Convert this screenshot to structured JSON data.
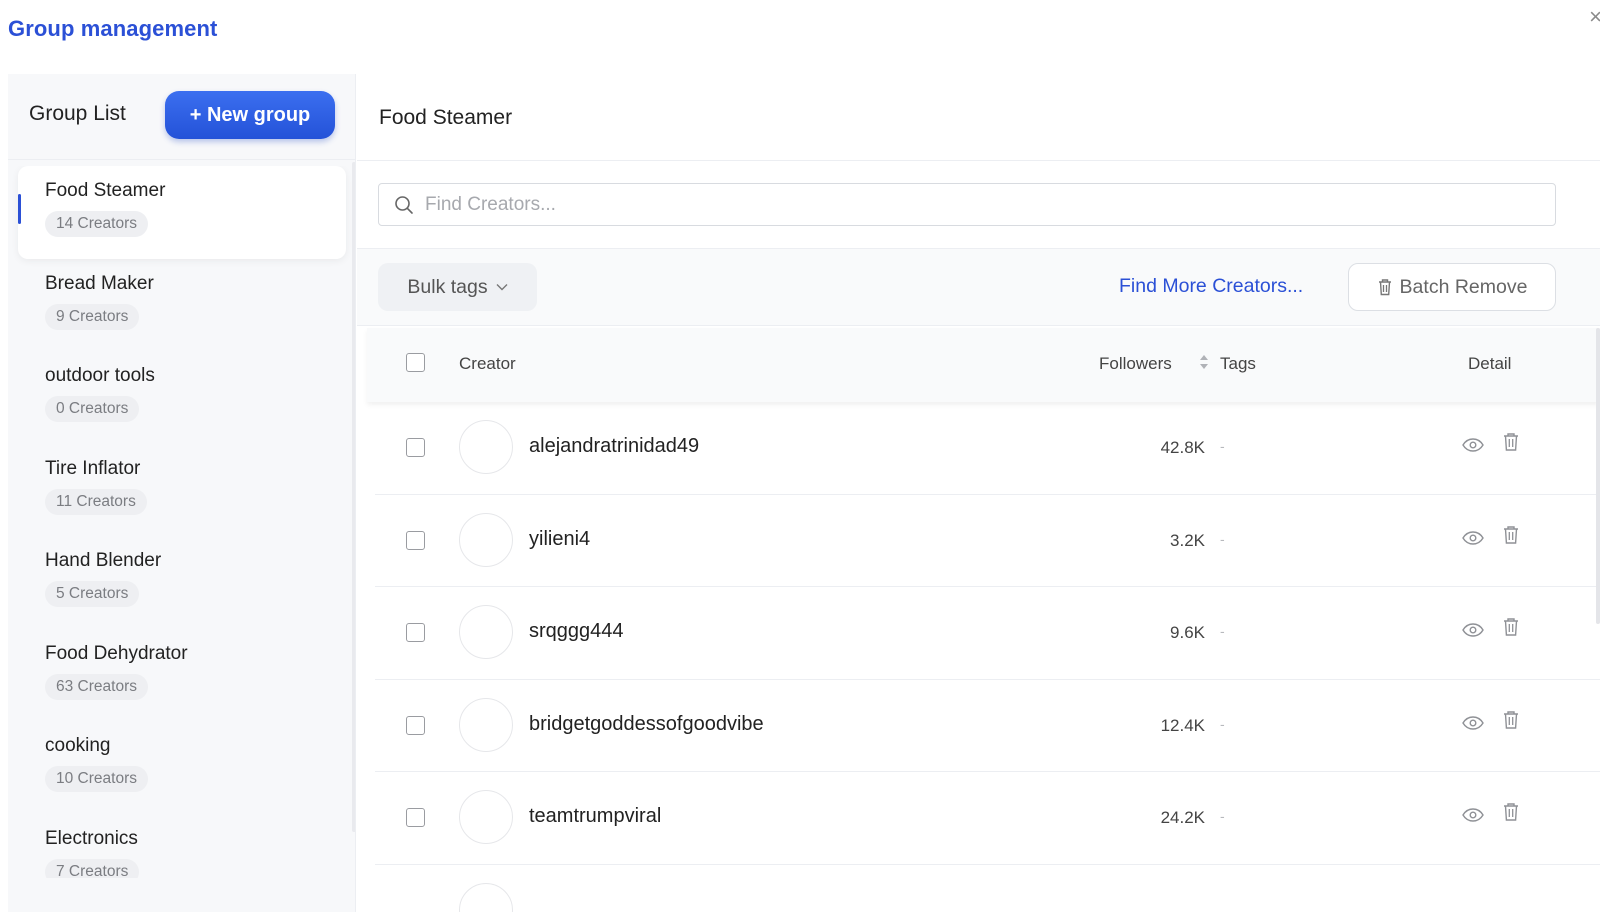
{
  "header": {
    "title": "Group management",
    "close_icon": "close-icon",
    "close_glyph": "×"
  },
  "sidebar": {
    "heading": "Group List",
    "new_group_label": "+ New group",
    "groups": [
      {
        "name": "Food Steamer",
        "count": "14 Creators",
        "active": true
      },
      {
        "name": "Bread Maker",
        "count": "9 Creators"
      },
      {
        "name": "outdoor tools",
        "count": "0 Creators"
      },
      {
        "name": "Tire Inflator",
        "count": "11 Creators"
      },
      {
        "name": "Hand Blender",
        "count": "5 Creators"
      },
      {
        "name": "Food Dehydrator",
        "count": "63 Creators"
      },
      {
        "name": "cooking",
        "count": "10 Creators"
      },
      {
        "name": "Electronics",
        "count": "7 Creators"
      }
    ]
  },
  "main": {
    "title": "Food Steamer",
    "search": {
      "placeholder": "Find Creators...",
      "value": ""
    },
    "toolbar": {
      "bulk_tags_label": "Bulk tags",
      "find_more_label": "Find More Creators...",
      "batch_remove_label": "Batch Remove"
    },
    "table": {
      "columns": {
        "creator": "Creator",
        "followers": "Followers",
        "tags": "Tags",
        "detail": "Detail"
      },
      "rows": [
        {
          "creator": "alejandratrinidad49",
          "followers": "42.8K",
          "tags": "-"
        },
        {
          "creator": "yilieni4",
          "followers": "3.2K",
          "tags": "-"
        },
        {
          "creator": "srqggg444",
          "followers": "9.6K",
          "tags": "-"
        },
        {
          "creator": "bridgetgoddessofgoodvibe",
          "followers": "12.4K",
          "tags": "-"
        },
        {
          "creator": "teamtrumpviral",
          "followers": "24.2K",
          "tags": "-"
        }
      ]
    }
  },
  "colors": {
    "accent": "#2b50d6",
    "button_gradient_top": "#3b6ff0",
    "button_gradient_bottom": "#2452d8"
  }
}
